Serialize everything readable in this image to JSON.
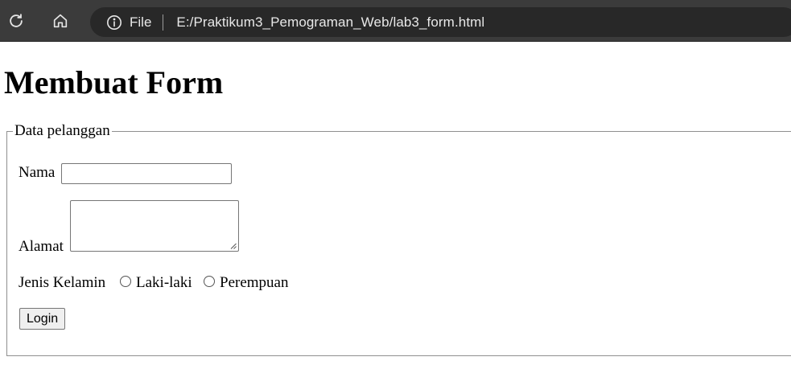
{
  "browser": {
    "icons": {
      "reload": "reload-icon",
      "home": "home-icon",
      "info": "info-icon"
    },
    "scheme_label": "File",
    "url": "E:/Praktikum3_Pemograman_Web/lab3_form.html"
  },
  "page": {
    "heading": "Membuat Form",
    "fieldset": {
      "legend": "Data pelanggan",
      "nama_label": "Nama",
      "nama_value": "",
      "alamat_label": "Alamat",
      "alamat_value": "",
      "gender_label": "Jenis Kelamin",
      "gender_options": [
        {
          "label": "Laki-laki",
          "checked": false
        },
        {
          "label": "Perempuan",
          "checked": false
        }
      ],
      "submit_label": "Login"
    }
  }
}
